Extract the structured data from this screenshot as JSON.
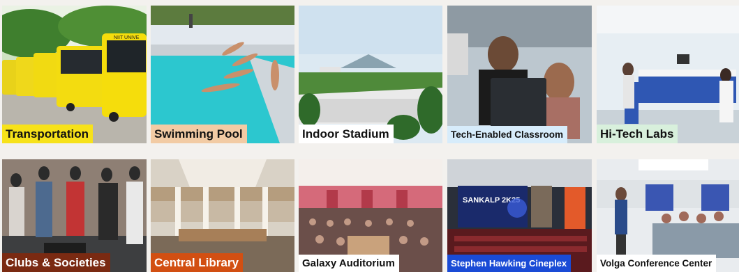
{
  "tiles": [
    {
      "label": "Transportation",
      "bg": "#f7e21a",
      "fg": "#111111"
    },
    {
      "label": "Swimming Pool",
      "bg": "#f2cba4",
      "fg": "#111111"
    },
    {
      "label": "Indoor Stadium",
      "bg": "#ffffff",
      "fg": "#111111"
    },
    {
      "label": "Tech-Enabled Classroom",
      "bg": "#d7ecfb",
      "fg": "#111111"
    },
    {
      "label": "Hi-Tech Labs",
      "bg": "#d8f0dc",
      "fg": "#111111"
    },
    {
      "label": "Clubs & Societies",
      "bg": "#7a2a12",
      "fg": "#ffffff"
    },
    {
      "label": "Central Library",
      "bg": "#d24f12",
      "fg": "#ffffff"
    },
    {
      "label": "Galaxy Auditorium",
      "bg": "#ffffff",
      "fg": "#111111"
    },
    {
      "label": "Stephen Hawking Cineplex",
      "bg": "#1a4bd6",
      "fg": "#ffffff"
    },
    {
      "label": "Volga Conference Center",
      "bg": "#ffffff",
      "fg": "#111111"
    }
  ],
  "photos": {
    "bus_brand": "NIIT UNIVE",
    "banner_title": "SANKALP 2K25"
  }
}
